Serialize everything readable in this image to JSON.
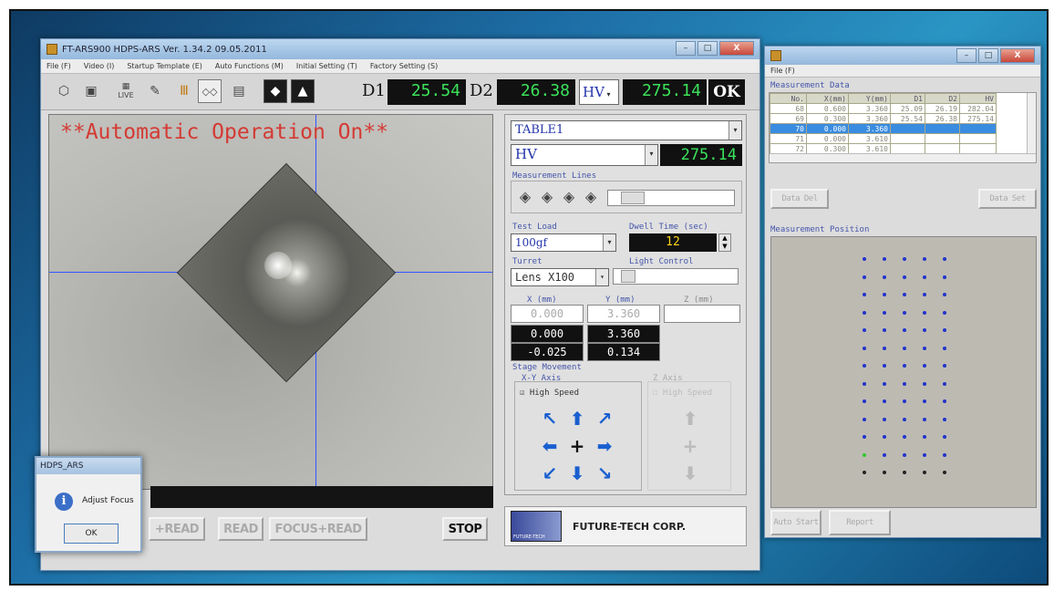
{
  "main_window": {
    "title": "FT-ARS900  HDPS-ARS Ver. 1.34.2  09.05.2011",
    "menu": [
      "File (F)",
      "Video (I)",
      "Startup Template (E)",
      "Auto Functions (M)",
      "Initial Setting (T)",
      "Factory Setting (S)"
    ],
    "toolbar_icons": [
      "open-icon",
      "save-icon",
      "live-icon",
      "edit-icon",
      "measure-icon",
      "pattern-icon",
      "grid-icon",
      "diamond-icon",
      "knoop-icon"
    ],
    "live_label": "LIVE",
    "d1_label": "D1",
    "d1_value": "25.54",
    "d2_label": "D2",
    "d2_value": "26.38",
    "hv_select": "HV",
    "hv_value": "275.14",
    "ok_label": "OK",
    "overlay_text": "**Automatic Operation On**",
    "buttons": {
      "focus_read_left": "+READ",
      "read": "READ",
      "focus_read": "FOCUS+READ",
      "stop": "STOP"
    },
    "table_select": "TABLE1",
    "hardness_select": "HV",
    "hardness_value": "275.14",
    "measurement_lines_label": "Measurement Lines",
    "test_load_label": "Test Load",
    "test_load_value": "100gf",
    "dwell_time_label": "Dwell Time (sec)",
    "dwell_time_value": "12",
    "turret_label": "Turret",
    "turret_value": "Lens X100",
    "light_control_label": "Light Control",
    "axis_headers": [
      "X (mm)",
      "Y (mm)",
      "Z (mm)"
    ],
    "coords": [
      [
        "0.000",
        "3.360"
      ],
      [
        "0.000",
        "3.360"
      ],
      [
        "-0.025",
        "0.134"
      ]
    ],
    "stage_movement_label": "Stage Movement",
    "xy_axis_label": "X-Y Axis",
    "z_axis_label": "Z Axis",
    "high_speed_label": "High Speed",
    "high_speed_checked": true,
    "company": "FUTURE-TECH CORP.",
    "logo_sub": "FUTURE-TECH"
  },
  "dialog": {
    "title": "HDPS_ARS",
    "message": "Adjust Focus",
    "ok": "OK"
  },
  "data_window": {
    "menu": "File (F)",
    "measurement_data_label": "Measurement Data",
    "columns": [
      "No.",
      "X(mm)",
      "Y(mm)",
      "D1",
      "D2",
      "HV"
    ],
    "rows": [
      [
        "68",
        "0.600",
        "3.360",
        "25.09",
        "26.19",
        "282.04"
      ],
      [
        "69",
        "0.300",
        "3.360",
        "25.54",
        "26.38",
        "275.14"
      ],
      [
        "70",
        "0.000",
        "3.360",
        "",
        "",
        ""
      ],
      [
        "71",
        "0.000",
        "3.610",
        "",
        "",
        ""
      ],
      [
        "72",
        "0.300",
        "3.610",
        "",
        "",
        ""
      ]
    ],
    "selected_row": 2,
    "data_del": "Data Del",
    "data_set": "Data Set",
    "measurement_position_label": "Measurement Position",
    "auto_start": "Auto Start",
    "report": "Report"
  },
  "colors": {
    "lcd_green": "#3be25a",
    "overlay_red": "#d43a34",
    "crosshair": "#3355ff",
    "arrow_blue": "#1a5fd0",
    "selection": "#3a8ce0"
  }
}
